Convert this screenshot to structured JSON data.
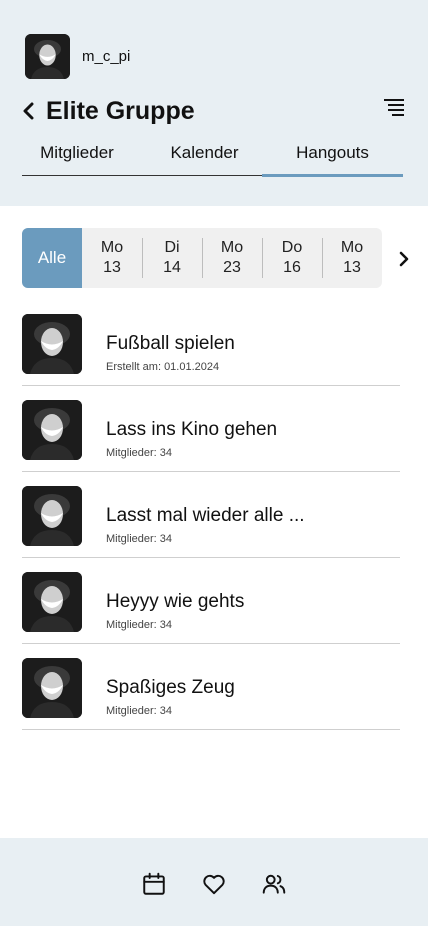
{
  "header": {
    "username": "m_c_pi",
    "title": "Elite Gruppe",
    "icons": {
      "back": "chevron-left-icon",
      "menu": "menu-lines-icon"
    }
  },
  "tabs": [
    {
      "label": "Mitglieder",
      "active": false
    },
    {
      "label": "Kalender",
      "active": false
    },
    {
      "label": "Hangouts",
      "active": true
    }
  ],
  "date_filter": {
    "all_label": "Alle",
    "days": [
      {
        "day": "Mo",
        "date": "13"
      },
      {
        "day": "Di",
        "date": "14"
      },
      {
        "day": "Mo",
        "date": "23"
      },
      {
        "day": "Do",
        "date": "16"
      },
      {
        "day": "Mo",
        "date": "13"
      }
    ]
  },
  "hangouts": [
    {
      "title": "Fußball spielen",
      "subtitle": "Erstellt am: 01.01.2024"
    },
    {
      "title": "Lass ins Kino gehen",
      "subtitle": "Mitglieder: 34"
    },
    {
      "title": "Lasst mal wieder alle ...",
      "subtitle": "Mitglieder: 34"
    },
    {
      "title": "Heyyy wie gehts",
      "subtitle": "Mitglieder: 34"
    },
    {
      "title": "Spaßiges Zeug",
      "subtitle": "Mitglieder: 34"
    }
  ],
  "bottom_nav": [
    {
      "icon": "calendar-icon"
    },
    {
      "icon": "heart-icon"
    },
    {
      "icon": "users-icon"
    }
  ],
  "colors": {
    "accent": "#6b9bbe",
    "header_bg": "#e8eff3",
    "date_bg": "#f0f0f0"
  }
}
